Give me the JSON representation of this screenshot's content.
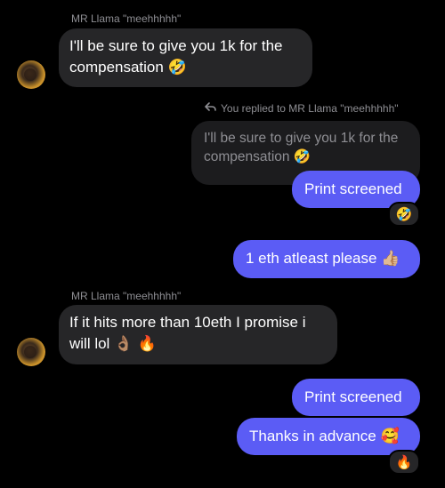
{
  "thread": {
    "sender_name": "MR Llama \"meehhhhh\"",
    "messages": {
      "m1": {
        "text": "I'll be sure to give you 1k for the compensation",
        "emoji": "🤣"
      },
      "reply_label": "You replied to MR Llama \"meehhhhh\"",
      "quoted": {
        "text": "I'll be sure to give you 1k for the compensation",
        "emoji": "🤣"
      },
      "m2": {
        "text": "Print screened",
        "reaction": "🤣"
      },
      "m3": {
        "text": "1 eth atleast please",
        "emoji": "👍🏼"
      },
      "m4": {
        "text": "If it hits more than 10eth I promise i will lol",
        "emoji": "👌🏽 🔥"
      },
      "m5": {
        "text": "Print screened"
      },
      "m6": {
        "text": "Thanks in advance",
        "emoji": "🥰",
        "reaction": "🔥"
      }
    }
  }
}
